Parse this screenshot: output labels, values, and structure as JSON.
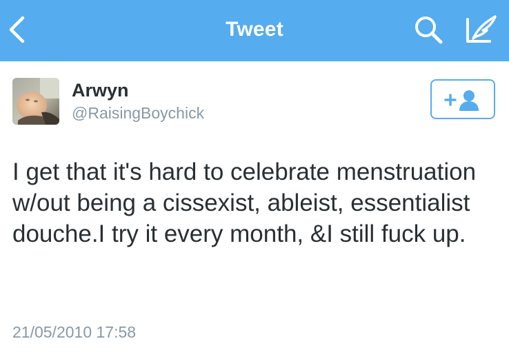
{
  "navbar": {
    "title": "Tweet",
    "back_icon": "chevron-left-icon",
    "search_icon": "search-icon",
    "compose_icon": "compose-tweet-icon",
    "background_color": "#55acee"
  },
  "tweet": {
    "author": {
      "display_name": "Arwyn",
      "handle": "@RaisingBoychick",
      "avatar_icon": "avatar-photo"
    },
    "follow_button": {
      "label": "+",
      "icon": "follow-user-icon"
    },
    "text": "I get that it's hard to celebrate menstruation w/out being a cissexist, ableist, essentialist douche.I try it every month, &I still fuck up.",
    "timestamp": "21/05/2010 17:58"
  },
  "colors": {
    "accent": "#55acee",
    "text_primary": "#292f33",
    "text_secondary": "#8899a6"
  }
}
